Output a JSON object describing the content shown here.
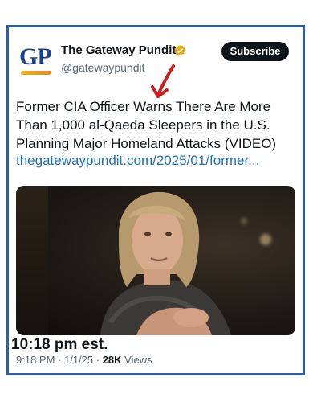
{
  "account": {
    "logo_text": "GP",
    "name": "The Gateway Pundit",
    "handle": "@gatewaypundit",
    "verified_icon": "gold-check-badge-icon",
    "subscribe_label": "Subscribe"
  },
  "tweet": {
    "lines": [
      "Former CIA Officer Warns There Are More",
      "Than 1,000 al-Qaeda Sleepers in the U.S.",
      "Planning Major Homeland Attacks (VIDEO)"
    ],
    "link": "thegatewaypundit.com/2025/01/former..."
  },
  "annotation": {
    "time_note": "10:18 pm est."
  },
  "meta": {
    "time": "9:18 PM",
    "sep1": " · ",
    "date": "1/1/25",
    "sep2": " · ",
    "views_count": "28K",
    "views_label": " Views"
  },
  "colors": {
    "frame_border": "#2f5fa3",
    "link": "#1d6fb8",
    "annotation_arrow": "#cc1f1f",
    "verified_gold": "#e8a91a"
  }
}
